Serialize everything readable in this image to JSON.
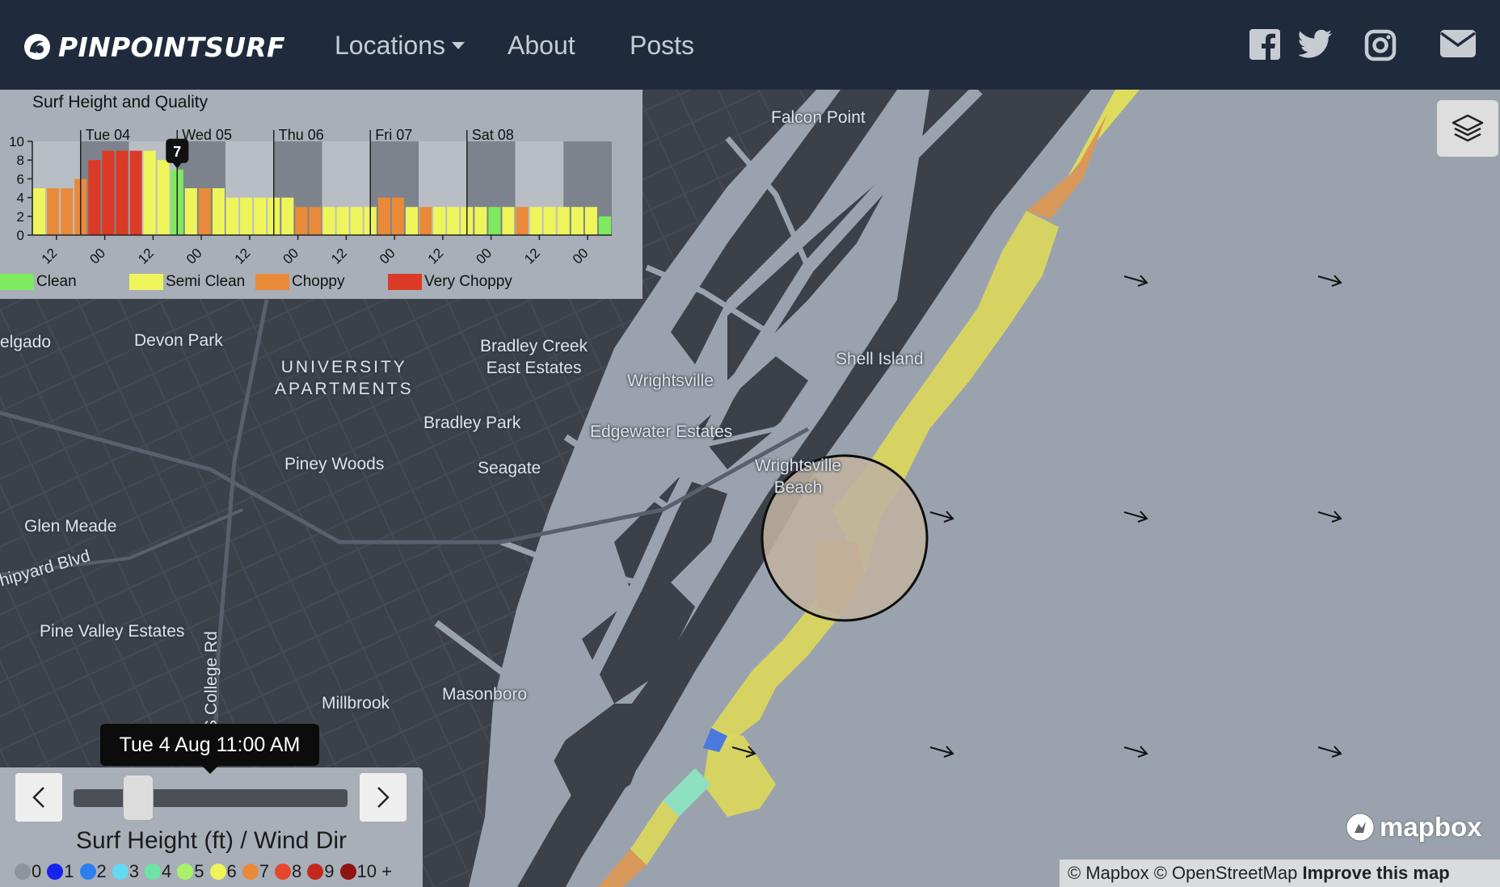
{
  "navbar": {
    "brand": "PINPOINTSURF",
    "links": {
      "locations": "Locations",
      "about": "About",
      "posts": "Posts"
    },
    "social_icons": [
      "facebook-icon",
      "twitter-icon",
      "instagram-icon",
      "email-icon"
    ]
  },
  "map": {
    "places": {
      "falcon_point": "Falcon Point",
      "shell_island": "Shell Island",
      "delgado": "elgado",
      "devon_park": "Devon Park",
      "university_1": "UNIVERSITY",
      "university_2": "APARTMENTS",
      "bradley_creek_1": "Bradley Creek",
      "bradley_creek_2": "East Estates",
      "wrightsville": "Wrightsville",
      "bradley_park": "Bradley Park",
      "edgewater": "Edgewater Estates",
      "piney_woods": "Piney Woods",
      "seagate": "Seagate",
      "wb_1": "Wrightsville",
      "wb_2": "Beach",
      "glen_meade": "Glen Meade",
      "shipyard": "hipyard Blvd",
      "pine_valley": "Pine Valley Estates",
      "college_rd": "S College Rd",
      "millbrook": "Millbrook",
      "masonboro": "Masonboro"
    },
    "wind_direction": "east",
    "attribution": {
      "mapbox": "© Mapbox",
      "osm": "© OpenStreetMap",
      "improve": "Improve this map"
    },
    "logo": "mapbox"
  },
  "chart_data": {
    "type": "bar",
    "title": "Surf Height and Quality",
    "day_labels": [
      "Tue 04",
      "Wed 05",
      "Thu 06",
      "Fri 07",
      "Sat 08"
    ],
    "y_ticks": [
      "0",
      "2",
      "4",
      "6",
      "8",
      "10"
    ],
    "x_ticks": [
      "12",
      "00",
      "12",
      "00",
      "12",
      "00",
      "12",
      "00",
      "12",
      "00",
      "12",
      "00"
    ],
    "ylim": [
      0,
      10
    ],
    "values": [
      5,
      5,
      5,
      6,
      8,
      9,
      9,
      9,
      9,
      8,
      7,
      5,
      5,
      5,
      4,
      4,
      4,
      4,
      4,
      3,
      3,
      3,
      3,
      3,
      3,
      4,
      4,
      3,
      3,
      3,
      3,
      3,
      3,
      3,
      3,
      3,
      3,
      3,
      3,
      3,
      3,
      2
    ],
    "qualities": [
      "semi",
      "choppy",
      "choppy",
      "choppy",
      "very",
      "very",
      "very",
      "very",
      "semi",
      "semi",
      "clean",
      "semi",
      "choppy",
      "semi",
      "semi",
      "semi",
      "semi",
      "semi",
      "semi",
      "choppy",
      "choppy",
      "semi",
      "semi",
      "semi",
      "semi",
      "choppy",
      "choppy",
      "semi",
      "choppy",
      "semi",
      "semi",
      "semi",
      "semi",
      "clean",
      "semi",
      "choppy",
      "semi",
      "semi",
      "semi",
      "semi",
      "semi",
      "clean"
    ],
    "marker_value": "7",
    "legend": [
      {
        "key": "clean",
        "label": "Clean",
        "color": "#7eea5e"
      },
      {
        "key": "semi",
        "label": "Semi Clean",
        "color": "#eef55a"
      },
      {
        "key": "choppy",
        "label": "Choppy",
        "color": "#e88a3a"
      },
      {
        "key": "very",
        "label": "Very Choppy",
        "color": "#db3a26"
      }
    ]
  },
  "time_control": {
    "current_time": "Tue 4 Aug 11:00 AM",
    "slider_position": 0.2,
    "scale_title": "Surf Height (ft) / Wind Dir",
    "scale": [
      {
        "label": "0",
        "color": "#8e949c"
      },
      {
        "label": "1",
        "color": "#1622ee"
      },
      {
        "label": "2",
        "color": "#2d7ef0"
      },
      {
        "label": "3",
        "color": "#65d9f3"
      },
      {
        "label": "4",
        "color": "#6fe3a5"
      },
      {
        "label": "5",
        "color": "#a8f36b"
      },
      {
        "label": "6",
        "color": "#eef55a"
      },
      {
        "label": "7",
        "color": "#e88a3a"
      },
      {
        "label": "8",
        "color": "#e8452d"
      },
      {
        "label": "9",
        "color": "#c3281d"
      },
      {
        "label": "10 +",
        "color": "#8e1414"
      }
    ]
  }
}
